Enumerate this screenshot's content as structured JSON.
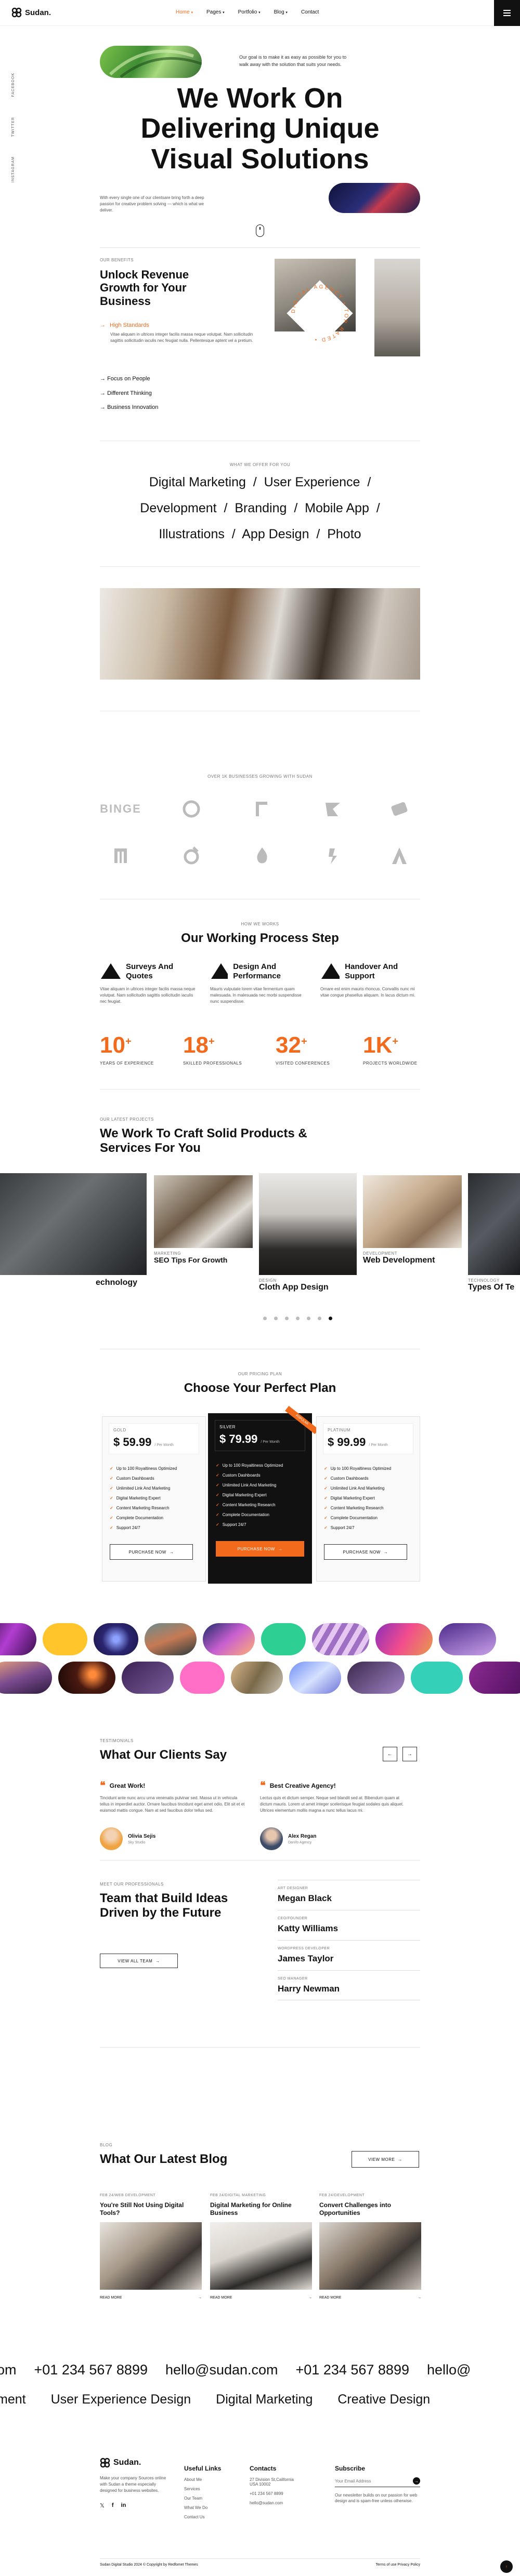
{
  "header": {
    "logo": "Sudan.",
    "nav": [
      {
        "label": "Home",
        "chevron": "▾",
        "active": true
      },
      {
        "label": "Pages",
        "chevron": "▾"
      },
      {
        "label": "Portfolio",
        "chevron": "▾"
      },
      {
        "label": "Blog",
        "chevron": "▾"
      },
      {
        "label": "Contact",
        "chevron": ""
      }
    ],
    "side_links": [
      "FACEBOOK",
      "TWITTER",
      "INSTAGRAM"
    ]
  },
  "hero": {
    "intro": "Our goal is to make it as easy as possible for you to walk away with the solution that suits your needs.",
    "title_lines": [
      "We Work On",
      "Delivering Unique",
      "Visual Solutions"
    ],
    "desc": "With every single one of our clientsare bring forth a deep passion for creative problem solving — which is what we deliver."
  },
  "benefits": {
    "tag": "OUR BENEFITS",
    "title": "Unlock Revenue Growth for Your Business",
    "item_active": "High Standards",
    "item_desc": "Vitae aliquam in ultrices integer facilis massa neque volutpat. Nam sollicitudin sagittis sollicitudin iaculis nec feugiat nulla. Pellentesque aptent vel a pretium.",
    "items": [
      "Focus on People",
      "Different Thinking",
      "Business Innovation"
    ],
    "badge": "DIGITAL AGENCY • TOP RATED •"
  },
  "services": {
    "tag": "WHAT WE OFFER FOR YOU",
    "rows": [
      [
        "Digital Marketing",
        "User Experience"
      ],
      [
        "Development",
        "Branding",
        "Mobile App"
      ],
      [
        "Illustrations",
        "App Design",
        "Photo"
      ]
    ]
  },
  "clients": {
    "tag": "OVER 1K BUSINESSES GROWING WITH SUDAN",
    "logos": [
      "BINGE",
      "",
      "",
      " ",
      "",
      "",
      "",
      "",
      "",
      ""
    ]
  },
  "process": {
    "tag": "HOW WE WORKS",
    "title": "Our Working Process Step",
    "steps": [
      {
        "title": "Surveys And Quotes",
        "desc": "Vitae aliquam in ultrices integer facilis massa neque volutpat. Nam sollicitudin sagittis sollicitudin iaculis nec feugiat."
      },
      {
        "title": "Design And Performance",
        "desc": "Mauris vulputate lorem vitae fermentum quam malesuada. In malesuada nec morbi suspendisse nunc suspendisse."
      },
      {
        "title": "Handover And Support",
        "desc": "Ornare est enim mauris rhoncus. Convallis nunc mi vitae congue phasellus aliquam. In lacus dictum mi."
      }
    ],
    "stats": [
      {
        "num": "10",
        "sup": "+",
        "label": "YEARS OF EXPERIENCE"
      },
      {
        "num": "18",
        "sup": "+",
        "label": "SKILLED PROFESSIONALS"
      },
      {
        "num": "32",
        "sup": "+",
        "label": "VISITED CONFERENCES"
      },
      {
        "num": "1K",
        "sup": "+",
        "label": "PROJECTS WORLDWIDE"
      }
    ]
  },
  "projects": {
    "tag": "OUR LATEST PROJECTS",
    "title": "We Work To Craft Solid Products & Services For You",
    "items": [
      {
        "cat": "",
        "title": "echnology"
      },
      {
        "cat": "MARKETING",
        "title": "SEO Tips For Growth"
      },
      {
        "cat": "DESIGN",
        "title": "Cloth App Design"
      },
      {
        "cat": "DEVELOPMENT",
        "title": "Web Development"
      },
      {
        "cat": "TECHNOLOGY",
        "title": "Types Of Te"
      }
    ]
  },
  "pricing": {
    "tag": "OUR PRICING PLAN",
    "title": "Choose Your Perfect Plan",
    "plans": [
      {
        "name": "GOLD",
        "price": "$ 59.99",
        "period": "/ Per Month",
        "button": "PURCHASE NOW"
      },
      {
        "name": "SILVER",
        "price": "$ 79.99",
        "period": "/ Per Month",
        "button": "PURCHASE NOW",
        "ribbon": "POPULAR"
      },
      {
        "name": "PLATINUM",
        "price": "$ 99.99",
        "period": "/ Per Month",
        "button": "PURCHASE NOW"
      }
    ],
    "features": [
      "Up to 100 Royaltiness Optimized",
      "Custom Dashboards",
      "Unlimited Link And Marketing",
      "Digital Marketing Expert",
      "Content Marketing Research",
      "Complete Documentation",
      "Support 24/7"
    ]
  },
  "testimonials": {
    "tag": "TESTIMONIALS",
    "title": "What Our Clients Say",
    "prev": "←",
    "next": "→",
    "items": [
      {
        "headline": "Great Work!",
        "text": "Tincidunt ante nunc arcu urna venenatis pulvinar sed. Massa ut in vehicula tellus in imperdiet auctor. Ornare faucibus tincidunt eget amet odio. Elit sit et et euismod mattis congue. Nam at sed faucibus dolor tellus sed.",
        "name": "Olivia Sejis",
        "role": "Sky Studio"
      },
      {
        "headline": "Best Creative Agency!",
        "text": "Lectus quis et dictum semper. Neque sed blandit sed at. Bibendum quam at dictum mauris. Lorem ut amet integer scelerisque feugiat sodales quis aliquet. Ultrices elementum mollis magna a nunc tellus lacus mi.",
        "name": "Alex Regan",
        "role": "Danifo Agency"
      }
    ]
  },
  "team": {
    "tag": "MEET OUR PROFESSIONALS",
    "title": "Team that Build Ideas Driven by the Future",
    "button": "VIEW ALL TEAM",
    "members": [
      {
        "role": "ART DESIGNER",
        "name": "Megan Black"
      },
      {
        "role": "CEO/FOUNDER",
        "name": "Katty Williams"
      },
      {
        "role": "WORDPRESS DEVELOPER",
        "name": "James Taylor"
      },
      {
        "role": "SEO MANAGER",
        "name": "Harry Newman"
      }
    ]
  },
  "blog": {
    "tag": "BLOG",
    "title": "What Our Latest Blog",
    "button": "VIEW MORE",
    "posts": [
      {
        "meta": "FEB 24/WEB DEVELOPMENT",
        "title": "You're Still Not Using Digital Tools?",
        "read": "READ MORE"
      },
      {
        "meta": "FEB 24/DIGITAL MARKETING",
        "title": "Digital Marketing for Online Business",
        "read": "READ MORE"
      },
      {
        "meta": "FEB 24/DEVELOPMENT",
        "title": "Convert Challenges into Opportunities",
        "read": "READ MORE"
      }
    ]
  },
  "marquee": {
    "row1": [
      "om",
      "+01 234 567 8899",
      "hello@sudan.com",
      "+01 234 567 8899",
      "hello@"
    ],
    "row2": [
      "ment",
      "User Experience Design",
      "Digital Marketing",
      "Creative Design"
    ]
  },
  "footer": {
    "logo": "Sudan.",
    "about": "Make your company Sources online with Sudan a theme especially designed for business websites.",
    "useful_title": "Useful Links",
    "useful": [
      "About Me",
      "Services",
      "Our Team",
      "What We Do",
      "Contact Us"
    ],
    "contacts_title": "Contacts",
    "contacts": [
      "27 Division St,California USA 10002",
      "+01 234 567 8899",
      "hello@sudan.com"
    ],
    "subscribe_title": "Subscribe",
    "subscribe_placeholder": "Your Email Address",
    "subscribe_note": "Our newsletter builds on our passion for web design and is spam-free unless otherwise.",
    "copyright": "Sudan Digital Studio 2024 © Copyright by Redfomet Themes",
    "legal": "Terms of use  Privacy Policy"
  },
  "colors": {
    "accent": "#f26b1d",
    "dark": "#111111"
  }
}
